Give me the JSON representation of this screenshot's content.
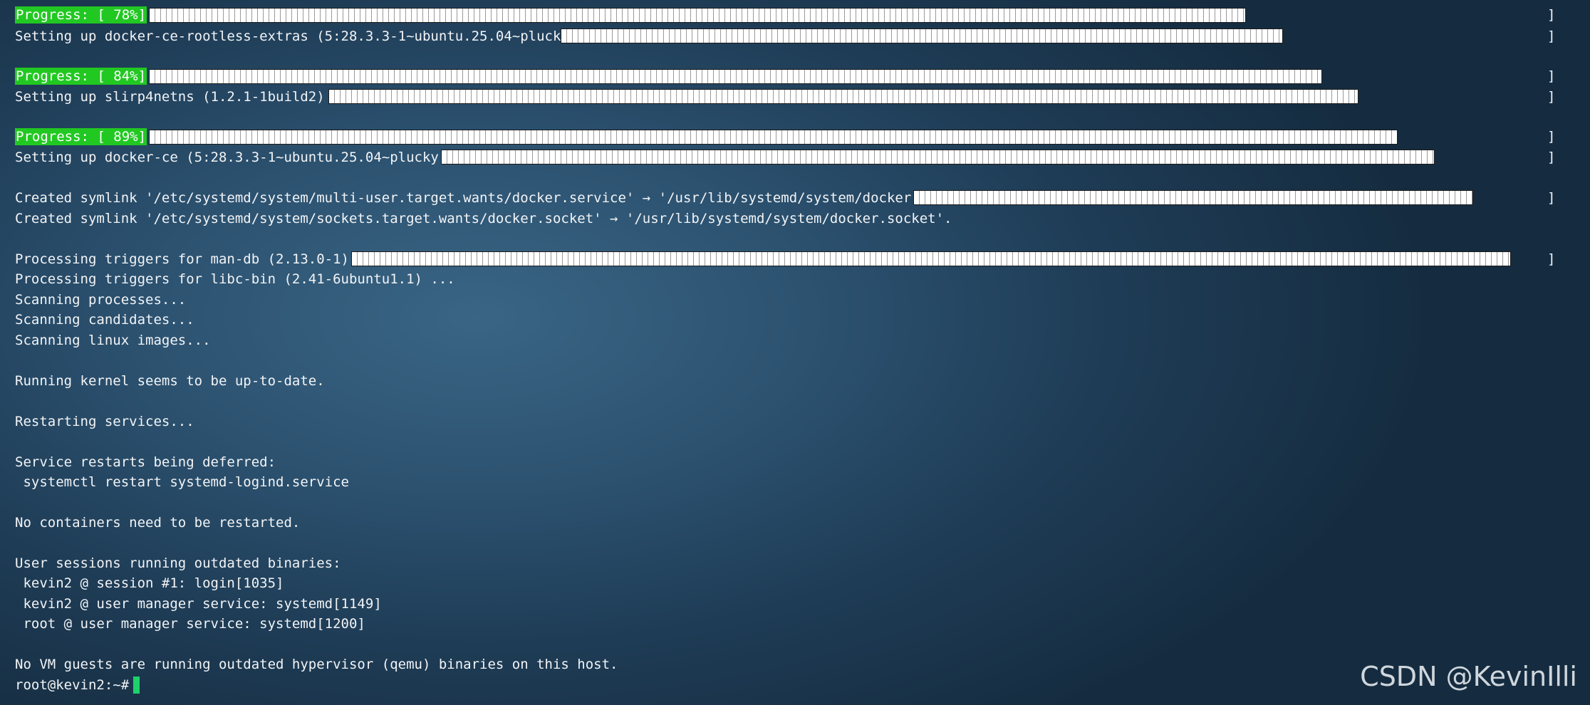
{
  "terminal": {
    "progress": [
      {
        "label": "Progress: [ 78%]",
        "open": "[",
        "value": 0.78
      },
      {
        "label": "Progress: [ 84%]",
        "open": "[",
        "value": 0.84
      },
      {
        "label": "Progress: [ 89%]",
        "open": "[",
        "value": 0.89
      }
    ],
    "bracket_close": "]",
    "lines": [
      "Setting up docker-ce-rootless-extras (5:28.3.3-1~ubuntu.25.04~plucky) ...",
      "Setting up slirp4netns (1.2.1-1build2) ...",
      "Setting up docker-ce (5:28.3.3-1~ubuntu.25.04~plucky) ...",
      "Created symlink '/etc/systemd/system/multi-user.target.wants/docker.service' → '/usr/lib/systemd/system/docker.service'.",
      "Created symlink '/etc/systemd/system/sockets.target.wants/docker.socket' → '/usr/lib/systemd/system/docker.socket'.",
      "Processing triggers for man-db (2.13.0-1) ...",
      "Processing triggers for libc-bin (2.41-6ubuntu1.1) ...",
      "Scanning processes...",
      "Scanning candidates...",
      "Scanning linux images...",
      "Running kernel seems to be up-to-date.",
      "Restarting services...",
      "Service restarts being deferred:",
      " systemctl restart systemd-logind.service",
      "No containers need to be restarted.",
      "User sessions running outdated binaries:",
      " kevin2 @ session #1: login[1035]",
      " kevin2 @ user manager service: systemd[1149]",
      " root @ user manager service: systemd[1200]",
      "No VM guests are running outdated hypervisor (qemu) binaries on this host."
    ],
    "prompt": "root@kevin2:~#"
  },
  "colors": {
    "progress_label_bg": "#22c822",
    "cursor": "#1fd16a"
  },
  "watermark": "CSDN @KevinIlli"
}
